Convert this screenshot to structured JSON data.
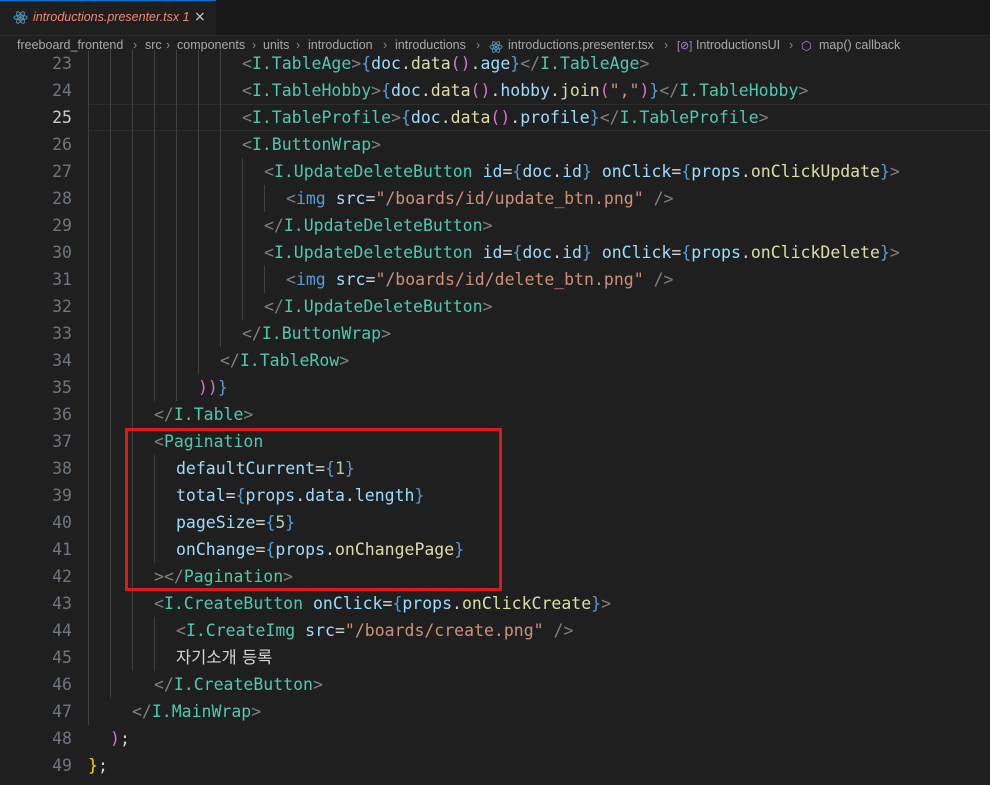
{
  "tab": {
    "filename": "introductions.presenter.tsx",
    "problems": "1",
    "close": "×"
  },
  "breadcrumb": {
    "items": [
      "freeboard_frontend",
      "src",
      "components",
      "units",
      "introduction",
      "introductions",
      "introductions.presenter.tsx",
      "IntroductionsUI",
      "map() callback"
    ]
  },
  "lines": [
    {
      "n": "23",
      "tokens": [
        [
          "tg",
          "<"
        ],
        [
          "cm",
          "I.TableAge"
        ],
        [
          "tg",
          ">"
        ],
        [
          "br",
          "{"
        ],
        [
          "vr",
          "doc"
        ],
        [
          "tx2",
          "."
        ],
        [
          "fn",
          "data"
        ],
        [
          "pk",
          "()"
        ],
        [
          "tx2",
          "."
        ],
        [
          "vr",
          "age"
        ],
        [
          "br",
          "}"
        ],
        [
          "tg",
          "</"
        ],
        [
          "cm",
          "I.TableAge"
        ],
        [
          "tg",
          ">"
        ]
      ]
    },
    {
      "n": "24",
      "tokens": [
        [
          "tg",
          "<"
        ],
        [
          "cm",
          "I.TableHobby"
        ],
        [
          "tg",
          ">"
        ],
        [
          "br",
          "{"
        ],
        [
          "vr",
          "doc"
        ],
        [
          "tx2",
          "."
        ],
        [
          "fn",
          "data"
        ],
        [
          "pk",
          "()"
        ],
        [
          "tx2",
          "."
        ],
        [
          "vr",
          "hobby"
        ],
        [
          "tx2",
          "."
        ],
        [
          "fn",
          "join"
        ],
        [
          "pk",
          "("
        ],
        [
          "st",
          "\",\""
        ],
        [
          "pk",
          ")"
        ],
        [
          "br",
          "}"
        ],
        [
          "tg",
          "</"
        ],
        [
          "cm",
          "I.TableHobby"
        ],
        [
          "tg",
          ">"
        ]
      ]
    },
    {
      "n": "25",
      "tokens": [
        [
          "tg",
          "<"
        ],
        [
          "cm",
          "I.TableProfile"
        ],
        [
          "tg",
          ">"
        ],
        [
          "br",
          "{"
        ],
        [
          "vr",
          "doc"
        ],
        [
          "tx2",
          "."
        ],
        [
          "fn",
          "data"
        ],
        [
          "pk",
          "()"
        ],
        [
          "tx2",
          "."
        ],
        [
          "vr",
          "profile"
        ],
        [
          "br",
          "}"
        ],
        [
          "tg",
          "</"
        ],
        [
          "cm",
          "I.TableProfile"
        ],
        [
          "tg",
          ">"
        ]
      ]
    },
    {
      "n": "26",
      "tokens": [
        [
          "tg",
          "<"
        ],
        [
          "cm",
          "I.ButtonWrap"
        ],
        [
          "tg",
          ">"
        ]
      ]
    },
    {
      "n": "27",
      "tokens": [
        [
          "tg",
          "<"
        ],
        [
          "cm",
          "I.UpdateDeleteButton"
        ],
        [
          "tx2",
          " "
        ],
        [
          "vr",
          "id"
        ],
        [
          "tx2",
          "="
        ],
        [
          "br",
          "{"
        ],
        [
          "vr",
          "doc"
        ],
        [
          "tx2",
          "."
        ],
        [
          "vr",
          "id"
        ],
        [
          "br",
          "}"
        ],
        [
          "tx2",
          " "
        ],
        [
          "vr",
          "onClick"
        ],
        [
          "tx2",
          "="
        ],
        [
          "br",
          "{"
        ],
        [
          "vr",
          "props"
        ],
        [
          "tx2",
          "."
        ],
        [
          "fn",
          "onClickUpdate"
        ],
        [
          "br",
          "}"
        ],
        [
          "tg",
          ">"
        ]
      ]
    },
    {
      "n": "28",
      "tokens": [
        [
          "tg",
          "<"
        ],
        [
          "br",
          "img"
        ],
        [
          "tx2",
          " "
        ],
        [
          "vr",
          "src"
        ],
        [
          "tx2",
          "="
        ],
        [
          "st",
          "\"/boards/id/update_btn.png\""
        ],
        [
          "tx2",
          " "
        ],
        [
          "tg",
          "/>"
        ]
      ]
    },
    {
      "n": "29",
      "tokens": [
        [
          "tg",
          "</"
        ],
        [
          "cm",
          "I.UpdateDeleteButton"
        ],
        [
          "tg",
          ">"
        ]
      ]
    },
    {
      "n": "30",
      "tokens": [
        [
          "tg",
          "<"
        ],
        [
          "cm",
          "I.UpdateDeleteButton"
        ],
        [
          "tx2",
          " "
        ],
        [
          "vr",
          "id"
        ],
        [
          "tx2",
          "="
        ],
        [
          "br",
          "{"
        ],
        [
          "vr",
          "doc"
        ],
        [
          "tx2",
          "."
        ],
        [
          "vr",
          "id"
        ],
        [
          "br",
          "}"
        ],
        [
          "tx2",
          " "
        ],
        [
          "vr",
          "onClick"
        ],
        [
          "tx2",
          "="
        ],
        [
          "br",
          "{"
        ],
        [
          "vr",
          "props"
        ],
        [
          "tx2",
          "."
        ],
        [
          "fn",
          "onClickDelete"
        ],
        [
          "br",
          "}"
        ],
        [
          "tg",
          ">"
        ]
      ]
    },
    {
      "n": "31",
      "tokens": [
        [
          "tg",
          "<"
        ],
        [
          "br",
          "img"
        ],
        [
          "tx2",
          " "
        ],
        [
          "vr",
          "src"
        ],
        [
          "tx2",
          "="
        ],
        [
          "st",
          "\"/boards/id/delete_btn.png\""
        ],
        [
          "tx2",
          " "
        ],
        [
          "tg",
          "/>"
        ]
      ]
    },
    {
      "n": "32",
      "tokens": [
        [
          "tg",
          "</"
        ],
        [
          "cm",
          "I.UpdateDeleteButton"
        ],
        [
          "tg",
          ">"
        ]
      ]
    },
    {
      "n": "33",
      "tokens": [
        [
          "tg",
          "</"
        ],
        [
          "cm",
          "I.ButtonWrap"
        ],
        [
          "tg",
          ">"
        ]
      ]
    },
    {
      "n": "34",
      "tokens": [
        [
          "tg",
          "</"
        ],
        [
          "cm",
          "I.TableRow"
        ],
        [
          "tg",
          ">"
        ]
      ]
    },
    {
      "n": "35",
      "tokens": [
        [
          "pk",
          "))"
        ],
        [
          "br",
          "}"
        ]
      ]
    },
    {
      "n": "36",
      "tokens": [
        [
          "tg",
          "</"
        ],
        [
          "cm",
          "I.Table"
        ],
        [
          "tg",
          ">"
        ]
      ]
    },
    {
      "n": "37",
      "tokens": [
        [
          "tg",
          "<"
        ],
        [
          "cm",
          "Pagination"
        ]
      ]
    },
    {
      "n": "38",
      "tokens": [
        [
          "vr",
          "defaultCurrent"
        ],
        [
          "tx2",
          "="
        ],
        [
          "br",
          "{"
        ],
        [
          "nm",
          "1"
        ],
        [
          "br",
          "}"
        ]
      ]
    },
    {
      "n": "39",
      "tokens": [
        [
          "vr",
          "total"
        ],
        [
          "tx2",
          "="
        ],
        [
          "br",
          "{"
        ],
        [
          "vr",
          "props"
        ],
        [
          "tx2",
          "."
        ],
        [
          "vr",
          "data"
        ],
        [
          "tx2",
          "."
        ],
        [
          "vr",
          "length"
        ],
        [
          "br",
          "}"
        ]
      ]
    },
    {
      "n": "40",
      "tokens": [
        [
          "vr",
          "pageSize"
        ],
        [
          "tx2",
          "="
        ],
        [
          "br",
          "{"
        ],
        [
          "nm",
          "5"
        ],
        [
          "br",
          "}"
        ]
      ]
    },
    {
      "n": "41",
      "tokens": [
        [
          "vr",
          "onChange"
        ],
        [
          "tx2",
          "="
        ],
        [
          "br",
          "{"
        ],
        [
          "vr",
          "props"
        ],
        [
          "tx2",
          "."
        ],
        [
          "fn",
          "onChangePage"
        ],
        [
          "br",
          "}"
        ]
      ]
    },
    {
      "n": "42",
      "tokens": [
        [
          "tg",
          "></"
        ],
        [
          "cm",
          "Pagination"
        ],
        [
          "tg",
          ">"
        ]
      ]
    },
    {
      "n": "43",
      "tokens": [
        [
          "tg",
          "<"
        ],
        [
          "cm",
          "I.CreateButton"
        ],
        [
          "tx2",
          " "
        ],
        [
          "vr",
          "onClick"
        ],
        [
          "tx2",
          "="
        ],
        [
          "br",
          "{"
        ],
        [
          "vr",
          "props"
        ],
        [
          "tx2",
          "."
        ],
        [
          "fn",
          "onClickCreate"
        ],
        [
          "br",
          "}"
        ],
        [
          "tg",
          ">"
        ]
      ]
    },
    {
      "n": "44",
      "tokens": [
        [
          "tg",
          "<"
        ],
        [
          "cm",
          "I.CreateImg"
        ],
        [
          "tx2",
          " "
        ],
        [
          "vr",
          "src"
        ],
        [
          "tx2",
          "="
        ],
        [
          "st",
          "\"/boards/create.png\""
        ],
        [
          "tx2",
          " "
        ],
        [
          "tg",
          "/>"
        ]
      ]
    },
    {
      "n": "45",
      "tokens": [
        [
          "tx",
          "자기소개 등록"
        ]
      ]
    },
    {
      "n": "46",
      "tokens": [
        [
          "tg",
          "</"
        ],
        [
          "cm",
          "I.CreateButton"
        ],
        [
          "tg",
          ">"
        ]
      ]
    },
    {
      "n": "47",
      "tokens": [
        [
          "tg",
          "</"
        ],
        [
          "cm",
          "I.MainWrap"
        ],
        [
          "tg",
          ">"
        ]
      ]
    },
    {
      "n": "48",
      "tokens": [
        [
          "pk",
          ")"
        ],
        [
          "tx2",
          ";"
        ]
      ]
    },
    {
      "n": "49",
      "tokens": [
        [
          "yl",
          "}"
        ],
        [
          "tx2",
          ";"
        ]
      ]
    }
  ]
}
